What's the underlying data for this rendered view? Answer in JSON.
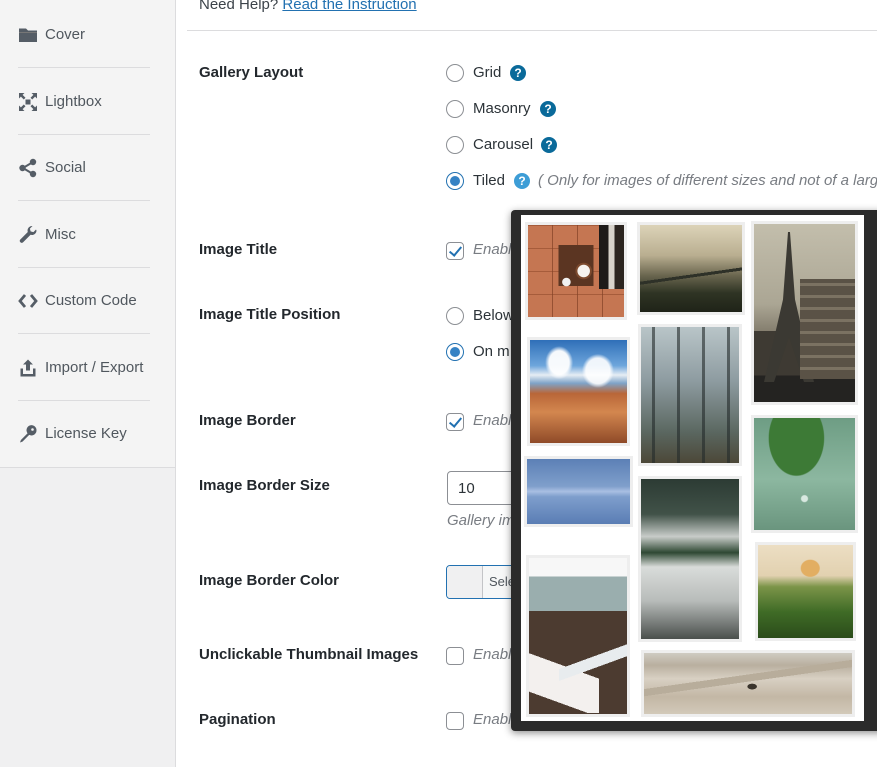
{
  "help": {
    "prefix": "Need Help?",
    "link_label": "Read the Instruction"
  },
  "sidebar": {
    "items": [
      {
        "label": "Cover",
        "icon": "folder-icon"
      },
      {
        "label": "Lightbox",
        "icon": "expand-icon"
      },
      {
        "label": "Social",
        "icon": "share-icon"
      },
      {
        "label": "Misc",
        "icon": "wrench-icon"
      },
      {
        "label": "Custom Code",
        "icon": "code-icon"
      },
      {
        "label": "Import / Export",
        "icon": "upload-icon"
      },
      {
        "label": "License Key",
        "icon": "key-icon"
      }
    ]
  },
  "settings": {
    "gallery_layout": {
      "label": "Gallery Layout",
      "help_icon": "question-circle-icon",
      "options": [
        {
          "label": "Grid",
          "checked": false
        },
        {
          "label": "Masonry",
          "checked": false
        },
        {
          "label": "Carousel",
          "checked": false
        },
        {
          "label": "Tiled",
          "checked": true,
          "note": "( Only for images of different sizes and not of a large s"
        }
      ]
    },
    "image_title": {
      "label": "Image Title",
      "checkbox_label": "Enable",
      "checked": true
    },
    "image_title_position": {
      "label": "Image Title Position",
      "options": [
        {
          "label": "Below",
          "checked": false
        },
        {
          "label": "On m",
          "checked": true
        }
      ]
    },
    "image_border": {
      "label": "Image Border",
      "checkbox_label": "Enable",
      "checked": true
    },
    "image_border_size": {
      "label": "Image Border Size",
      "value": "10",
      "description": "Gallery im"
    },
    "image_border_color": {
      "label": "Image Border Color",
      "button_label": "Select Color"
    },
    "unclickable_thumbnails": {
      "label": "Unclickable Thumbnail Images",
      "checkbox_label": "Enable",
      "checked": false
    },
    "pagination": {
      "label": "Pagination",
      "checkbox_label": "Enable",
      "checked": false
    }
  },
  "preview": {
    "images": [
      {
        "alt": "Coffee cup on terracotta tiles"
      },
      {
        "alt": "Misty bridge in forest"
      },
      {
        "alt": "Eiffel Tower and Paris buildings"
      },
      {
        "alt": "Red rock canyon under blue sky"
      },
      {
        "alt": "Foggy pine forest"
      },
      {
        "alt": "Water drop on green leaf"
      },
      {
        "alt": "Calm blue lake reflection"
      },
      {
        "alt": "Fog over forest lake"
      },
      {
        "alt": "Desk with computer and keyboard"
      },
      {
        "alt": "Hot air balloon over palm trees"
      },
      {
        "alt": "Desert sand dunes"
      }
    ]
  },
  "colors": {
    "accent": "#2271b1",
    "help_icon": "#0a6a9a",
    "help_icon_active": "#3d9dd6",
    "popup_frame": "#2b2b2b",
    "sidebar_bg": "#f4f4f4"
  }
}
